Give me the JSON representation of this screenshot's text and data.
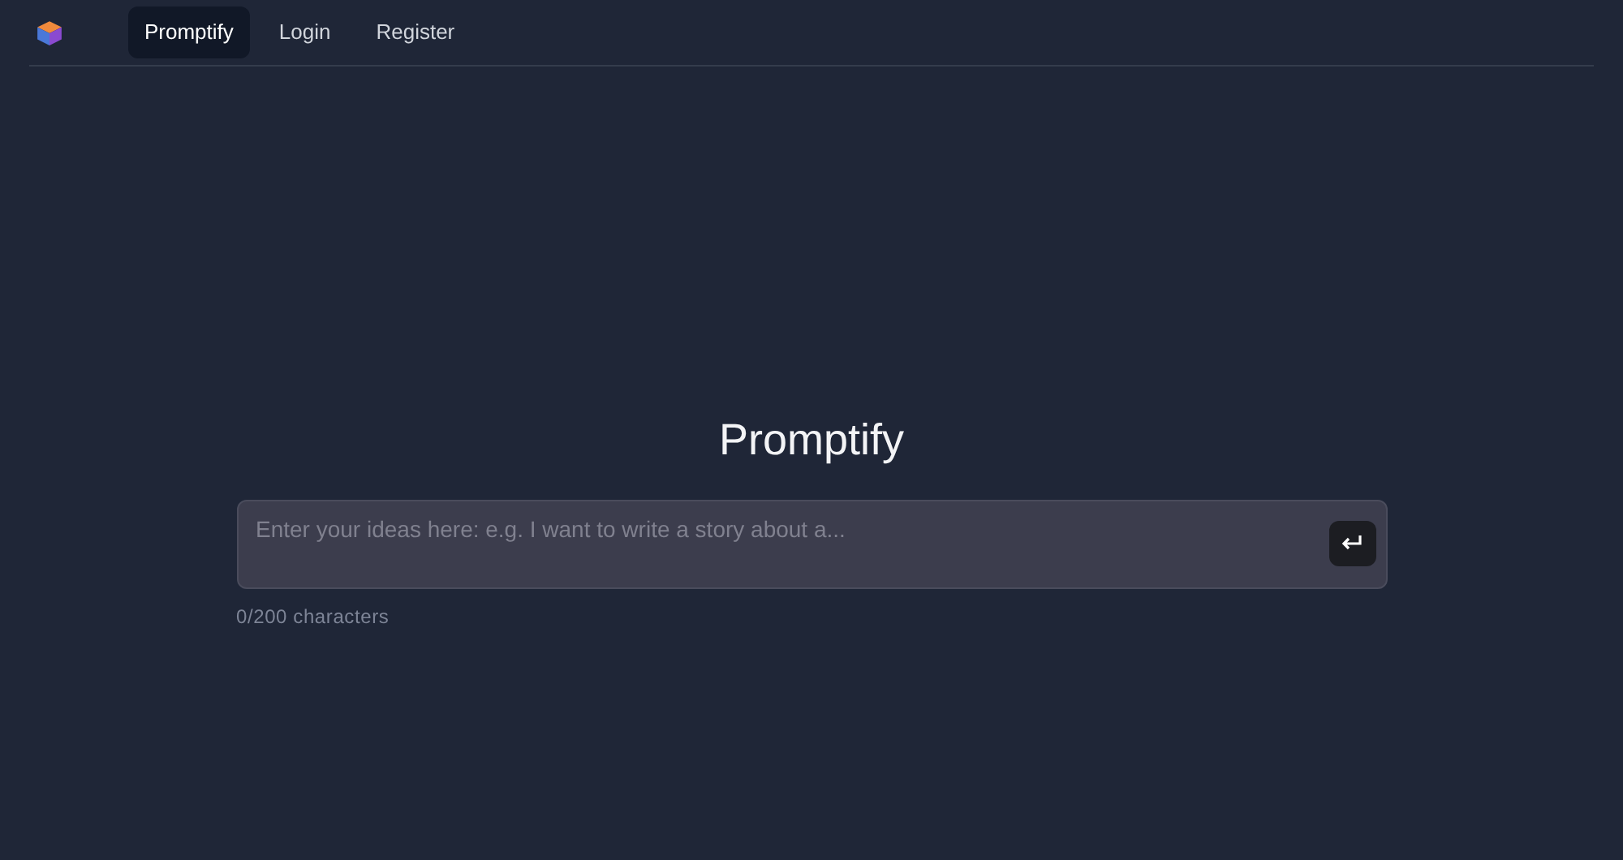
{
  "nav": {
    "links": [
      {
        "label": "Promptify",
        "selected": true
      },
      {
        "label": "Login",
        "selected": false
      },
      {
        "label": "Register",
        "selected": false
      }
    ]
  },
  "main": {
    "title": "Promptify",
    "prompt": {
      "placeholder": "Enter your ideas here: e.g. I want to write a story about a..."
    },
    "counter": "0/200 characters"
  }
}
